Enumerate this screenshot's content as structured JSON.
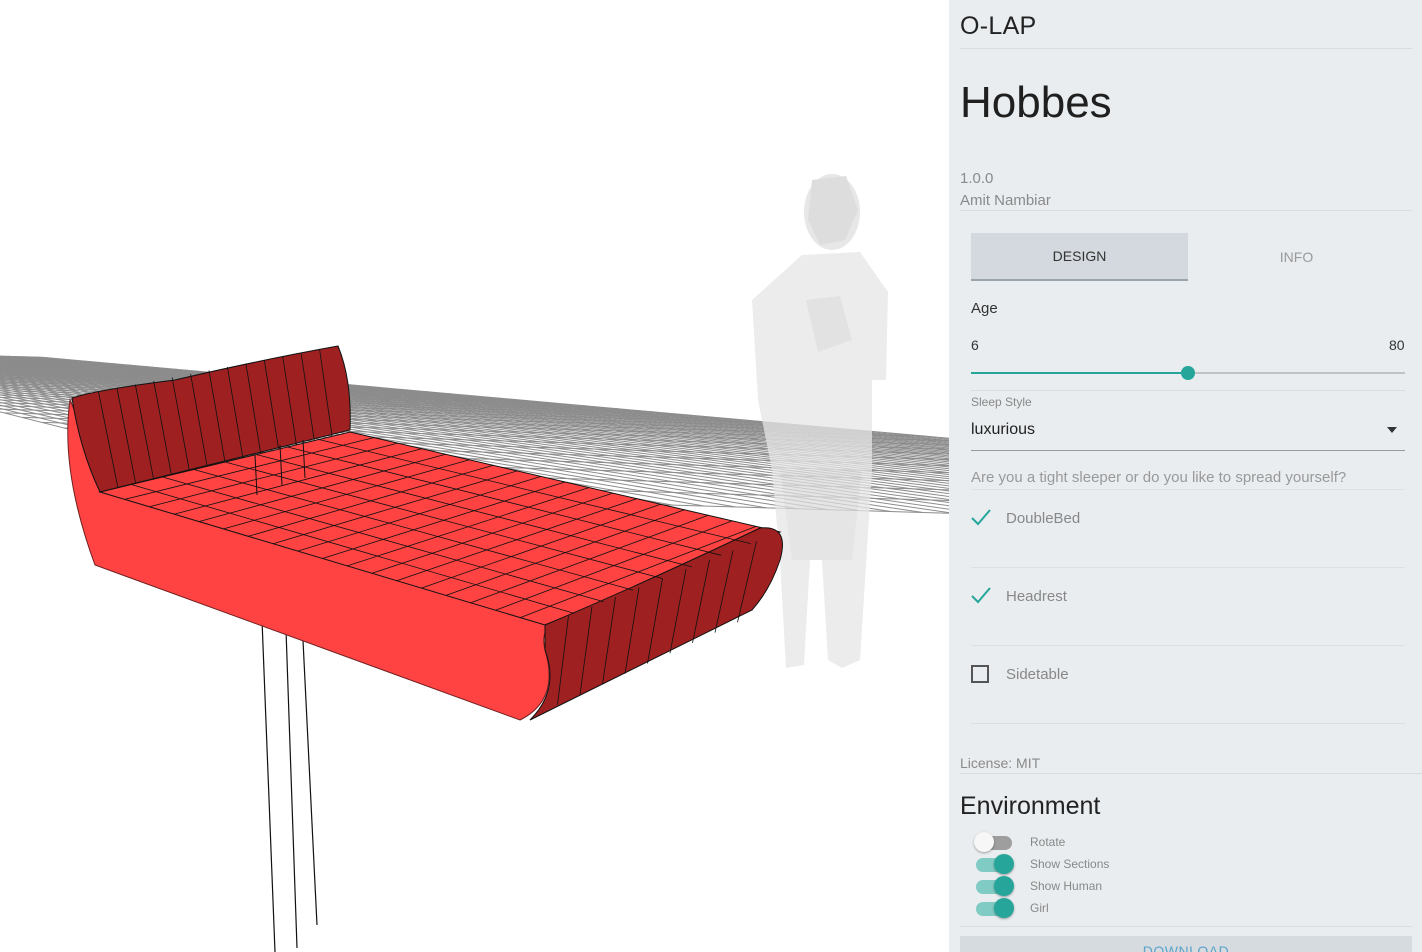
{
  "app": {
    "brand": "O-LAP"
  },
  "product": {
    "name": "Hobbes",
    "version": "1.0.0",
    "author": "Amit Nambiar",
    "license": "License: MIT"
  },
  "tabs": [
    {
      "label": "DESIGN",
      "active": true
    },
    {
      "label": "INFO",
      "active": false
    }
  ],
  "design": {
    "age": {
      "label": "Age",
      "min": "6",
      "max": "80",
      "value_fraction": 0.5
    },
    "sleep_style": {
      "label": "Sleep Style",
      "value": "luxurious"
    },
    "hint": "Are you a tight sleeper or do you like to spread yourself?",
    "options": [
      {
        "label": "DoubleBed",
        "checked": true
      },
      {
        "label": "Headrest",
        "checked": true
      },
      {
        "label": "Sidetable",
        "checked": false
      }
    ]
  },
  "environment": {
    "title": "Environment",
    "toggles": [
      {
        "label": "Rotate",
        "on": false
      },
      {
        "label": "Show Sections",
        "on": true
      },
      {
        "label": "Show Human",
        "on": true
      },
      {
        "label": "Girl",
        "on": true
      }
    ]
  },
  "actions": {
    "download": "DOWNLOAD"
  },
  "colors": {
    "accent": "#26a69a",
    "bed": "#ff4242",
    "bed_dark": "#9e2020",
    "panel_bg": "#e9edf0",
    "download_text": "#5ba4c9"
  }
}
